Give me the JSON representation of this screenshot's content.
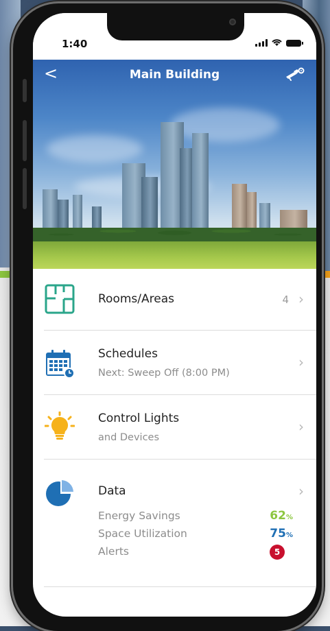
{
  "status": {
    "time": "1:40"
  },
  "header": {
    "title": "Main Building",
    "back_glyph": "<"
  },
  "colors": {
    "accent_green": "#8cc63f",
    "accent_blue": "#1f6fb4",
    "alert_red": "#c8102e",
    "teal_icon": "#2aa58a"
  },
  "menu": {
    "rooms": {
      "label": "Rooms/Areas",
      "count": "4",
      "icon": "floor-plan-icon"
    },
    "schedules": {
      "label": "Schedules",
      "sub": "Next: Sweep Off (8:00 PM)",
      "icon": "calendar-icon"
    },
    "lights": {
      "label": "Control Lights",
      "sub": "and Devices",
      "icon": "lightbulb-icon"
    },
    "data": {
      "label": "Data",
      "icon": "pie-chart-icon",
      "energy_label": "Energy Savings",
      "energy_value": "62",
      "space_label": "Space Utilization",
      "space_value": "75",
      "pct_unit": "%",
      "alerts_label": "Alerts",
      "alerts_count": "5"
    }
  }
}
